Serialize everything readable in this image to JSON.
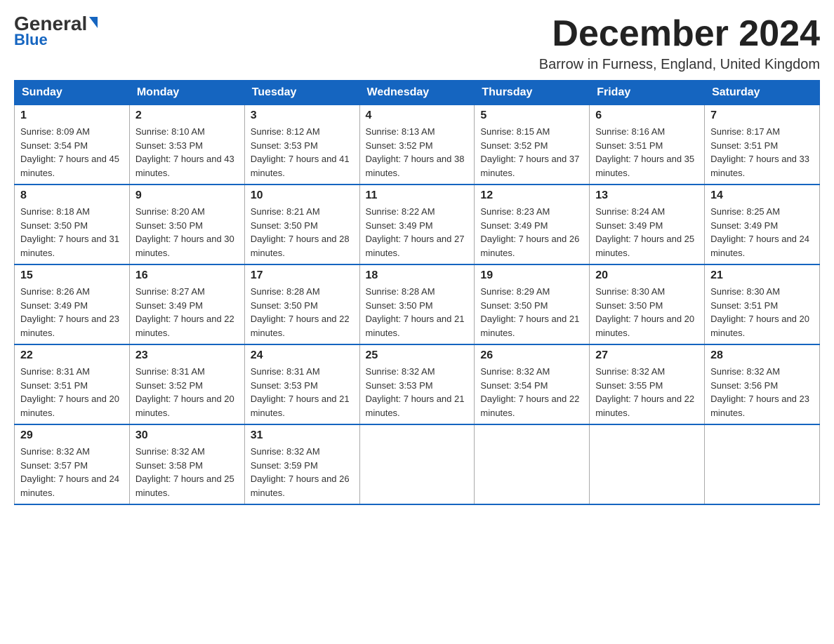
{
  "logo": {
    "general": "General",
    "triangle": "▶",
    "blue": "Blue"
  },
  "header": {
    "title": "December 2024",
    "location": "Barrow in Furness, England, United Kingdom"
  },
  "weekdays": [
    "Sunday",
    "Monday",
    "Tuesday",
    "Wednesday",
    "Thursday",
    "Friday",
    "Saturday"
  ],
  "weeks": [
    [
      {
        "day": "1",
        "sunrise": "8:09 AM",
        "sunset": "3:54 PM",
        "daylight": "7 hours and 45 minutes."
      },
      {
        "day": "2",
        "sunrise": "8:10 AM",
        "sunset": "3:53 PM",
        "daylight": "7 hours and 43 minutes."
      },
      {
        "day": "3",
        "sunrise": "8:12 AM",
        "sunset": "3:53 PM",
        "daylight": "7 hours and 41 minutes."
      },
      {
        "day": "4",
        "sunrise": "8:13 AM",
        "sunset": "3:52 PM",
        "daylight": "7 hours and 38 minutes."
      },
      {
        "day": "5",
        "sunrise": "8:15 AM",
        "sunset": "3:52 PM",
        "daylight": "7 hours and 37 minutes."
      },
      {
        "day": "6",
        "sunrise": "8:16 AM",
        "sunset": "3:51 PM",
        "daylight": "7 hours and 35 minutes."
      },
      {
        "day": "7",
        "sunrise": "8:17 AM",
        "sunset": "3:51 PM",
        "daylight": "7 hours and 33 minutes."
      }
    ],
    [
      {
        "day": "8",
        "sunrise": "8:18 AM",
        "sunset": "3:50 PM",
        "daylight": "7 hours and 31 minutes."
      },
      {
        "day": "9",
        "sunrise": "8:20 AM",
        "sunset": "3:50 PM",
        "daylight": "7 hours and 30 minutes."
      },
      {
        "day": "10",
        "sunrise": "8:21 AM",
        "sunset": "3:50 PM",
        "daylight": "7 hours and 28 minutes."
      },
      {
        "day": "11",
        "sunrise": "8:22 AM",
        "sunset": "3:49 PM",
        "daylight": "7 hours and 27 minutes."
      },
      {
        "day": "12",
        "sunrise": "8:23 AM",
        "sunset": "3:49 PM",
        "daylight": "7 hours and 26 minutes."
      },
      {
        "day": "13",
        "sunrise": "8:24 AM",
        "sunset": "3:49 PM",
        "daylight": "7 hours and 25 minutes."
      },
      {
        "day": "14",
        "sunrise": "8:25 AM",
        "sunset": "3:49 PM",
        "daylight": "7 hours and 24 minutes."
      }
    ],
    [
      {
        "day": "15",
        "sunrise": "8:26 AM",
        "sunset": "3:49 PM",
        "daylight": "7 hours and 23 minutes."
      },
      {
        "day": "16",
        "sunrise": "8:27 AM",
        "sunset": "3:49 PM",
        "daylight": "7 hours and 22 minutes."
      },
      {
        "day": "17",
        "sunrise": "8:28 AM",
        "sunset": "3:50 PM",
        "daylight": "7 hours and 22 minutes."
      },
      {
        "day": "18",
        "sunrise": "8:28 AM",
        "sunset": "3:50 PM",
        "daylight": "7 hours and 21 minutes."
      },
      {
        "day": "19",
        "sunrise": "8:29 AM",
        "sunset": "3:50 PM",
        "daylight": "7 hours and 21 minutes."
      },
      {
        "day": "20",
        "sunrise": "8:30 AM",
        "sunset": "3:50 PM",
        "daylight": "7 hours and 20 minutes."
      },
      {
        "day": "21",
        "sunrise": "8:30 AM",
        "sunset": "3:51 PM",
        "daylight": "7 hours and 20 minutes."
      }
    ],
    [
      {
        "day": "22",
        "sunrise": "8:31 AM",
        "sunset": "3:51 PM",
        "daylight": "7 hours and 20 minutes."
      },
      {
        "day": "23",
        "sunrise": "8:31 AM",
        "sunset": "3:52 PM",
        "daylight": "7 hours and 20 minutes."
      },
      {
        "day": "24",
        "sunrise": "8:31 AM",
        "sunset": "3:53 PM",
        "daylight": "7 hours and 21 minutes."
      },
      {
        "day": "25",
        "sunrise": "8:32 AM",
        "sunset": "3:53 PM",
        "daylight": "7 hours and 21 minutes."
      },
      {
        "day": "26",
        "sunrise": "8:32 AM",
        "sunset": "3:54 PM",
        "daylight": "7 hours and 22 minutes."
      },
      {
        "day": "27",
        "sunrise": "8:32 AM",
        "sunset": "3:55 PM",
        "daylight": "7 hours and 22 minutes."
      },
      {
        "day": "28",
        "sunrise": "8:32 AM",
        "sunset": "3:56 PM",
        "daylight": "7 hours and 23 minutes."
      }
    ],
    [
      {
        "day": "29",
        "sunrise": "8:32 AM",
        "sunset": "3:57 PM",
        "daylight": "7 hours and 24 minutes."
      },
      {
        "day": "30",
        "sunrise": "8:32 AM",
        "sunset": "3:58 PM",
        "daylight": "7 hours and 25 minutes."
      },
      {
        "day": "31",
        "sunrise": "8:32 AM",
        "sunset": "3:59 PM",
        "daylight": "7 hours and 26 minutes."
      },
      null,
      null,
      null,
      null
    ]
  ]
}
